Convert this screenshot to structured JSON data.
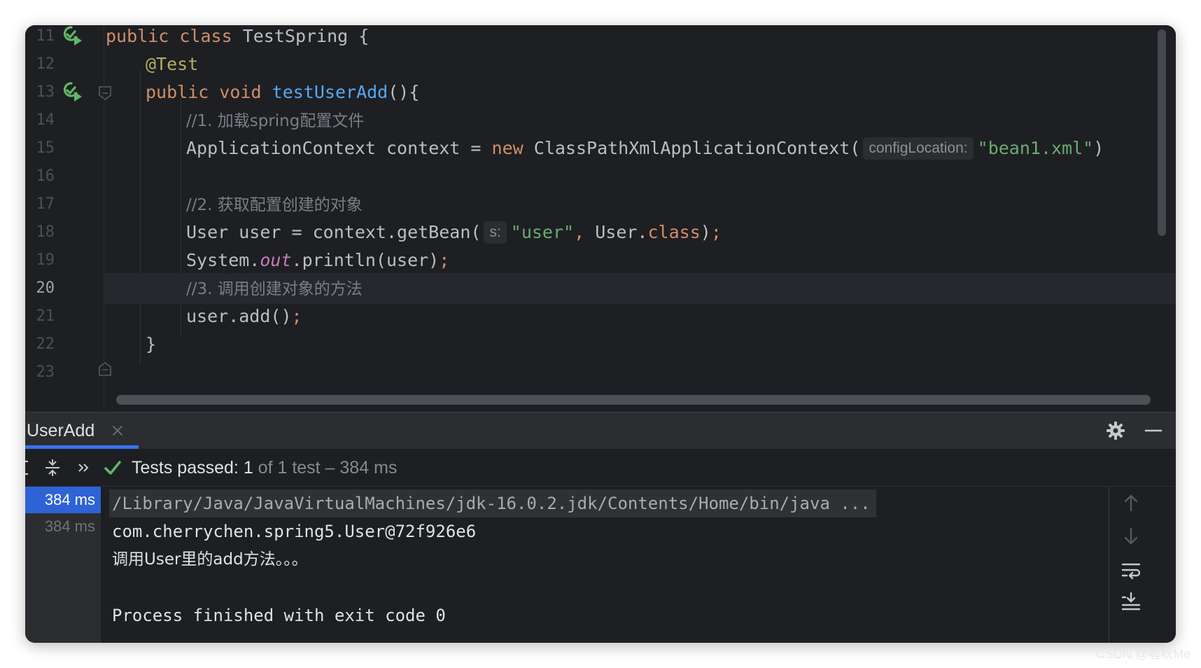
{
  "editor": {
    "line_numbers": [
      "11",
      "12",
      "13",
      "14",
      "15",
      "16",
      "17",
      "18",
      "19",
      "20",
      "21",
      "22",
      "23"
    ],
    "current_line": "20",
    "code": {
      "l11": {
        "kw1": "public",
        "kw2": "class",
        "name": "TestSpring",
        "brace": "{"
      },
      "l12": {
        "annotation": "@Test"
      },
      "l13": {
        "kw1": "public",
        "kw2": "void",
        "method": "testUserAdd",
        "rest": "(){"
      },
      "l14": {
        "comment": "//1. 加载spring配置文件"
      },
      "l15": {
        "type": "ApplicationContext",
        "var": "context",
        "eq": "=",
        "kw": "new",
        "ctor": "ClassPathXmlApplicationContext(",
        "hint": "configLocation:",
        "arg": "\"bean1.xml\"",
        "end": ")"
      },
      "l17": {
        "comment": "//2. 获取配置创建的对象"
      },
      "l18": {
        "start": "User user = context.getBean(",
        "hint": "s:",
        "arg": "\"user\"",
        "comma": ",",
        "mid": "User.",
        "kw": "class",
        "close": ")",
        "semi": ";"
      },
      "l19": {
        "start": "System.",
        "field": "out",
        "mid": ".println(user)",
        "semi": ";"
      },
      "l20": {
        "comment": "//3. 调用创建对象的方法"
      },
      "l21": {
        "start": "user.add()",
        "semi": ";"
      },
      "l22": {
        "brace": "}"
      }
    }
  },
  "run_panel": {
    "tab_label": "UserAdd",
    "status": {
      "passed": "Tests passed:",
      "count": "1",
      "rest": "of 1 test – 384 ms"
    },
    "tree": [
      {
        "label": "384 ms",
        "selected": true
      },
      {
        "label": "384 ms",
        "selected": false
      }
    ],
    "console": {
      "cmd": "/Library/Java/JavaVirtualMachines/jdk-16.0.2.jdk/Contents/Home/bin/java ...",
      "out1": "com.cherrychen.spring5.User@72f926e6",
      "out2": "调用User里的add方法。。。",
      "out3": "",
      "out4": "Process finished with exit code 0"
    }
  },
  "watermark": "CSDN @喔秋Me",
  "colors": {
    "background": "#1e1f22",
    "keyword": "#cf8e6d",
    "annotation": "#b3ae60",
    "method": "#56a8f5",
    "string": "#6aab73",
    "comment": "#7a7e85",
    "field": "#c77dbb",
    "accent": "#3574f0",
    "success": "#5fb865"
  },
  "icons": [
    "run-test-icon",
    "fold-icon",
    "close-icon",
    "gear-icon",
    "minimize-icon",
    "collapse-all-icon",
    "more-icon",
    "check-icon",
    "arrow-up-icon",
    "arrow-down-icon",
    "soft-wrap-icon",
    "scroll-to-end-icon"
  ]
}
